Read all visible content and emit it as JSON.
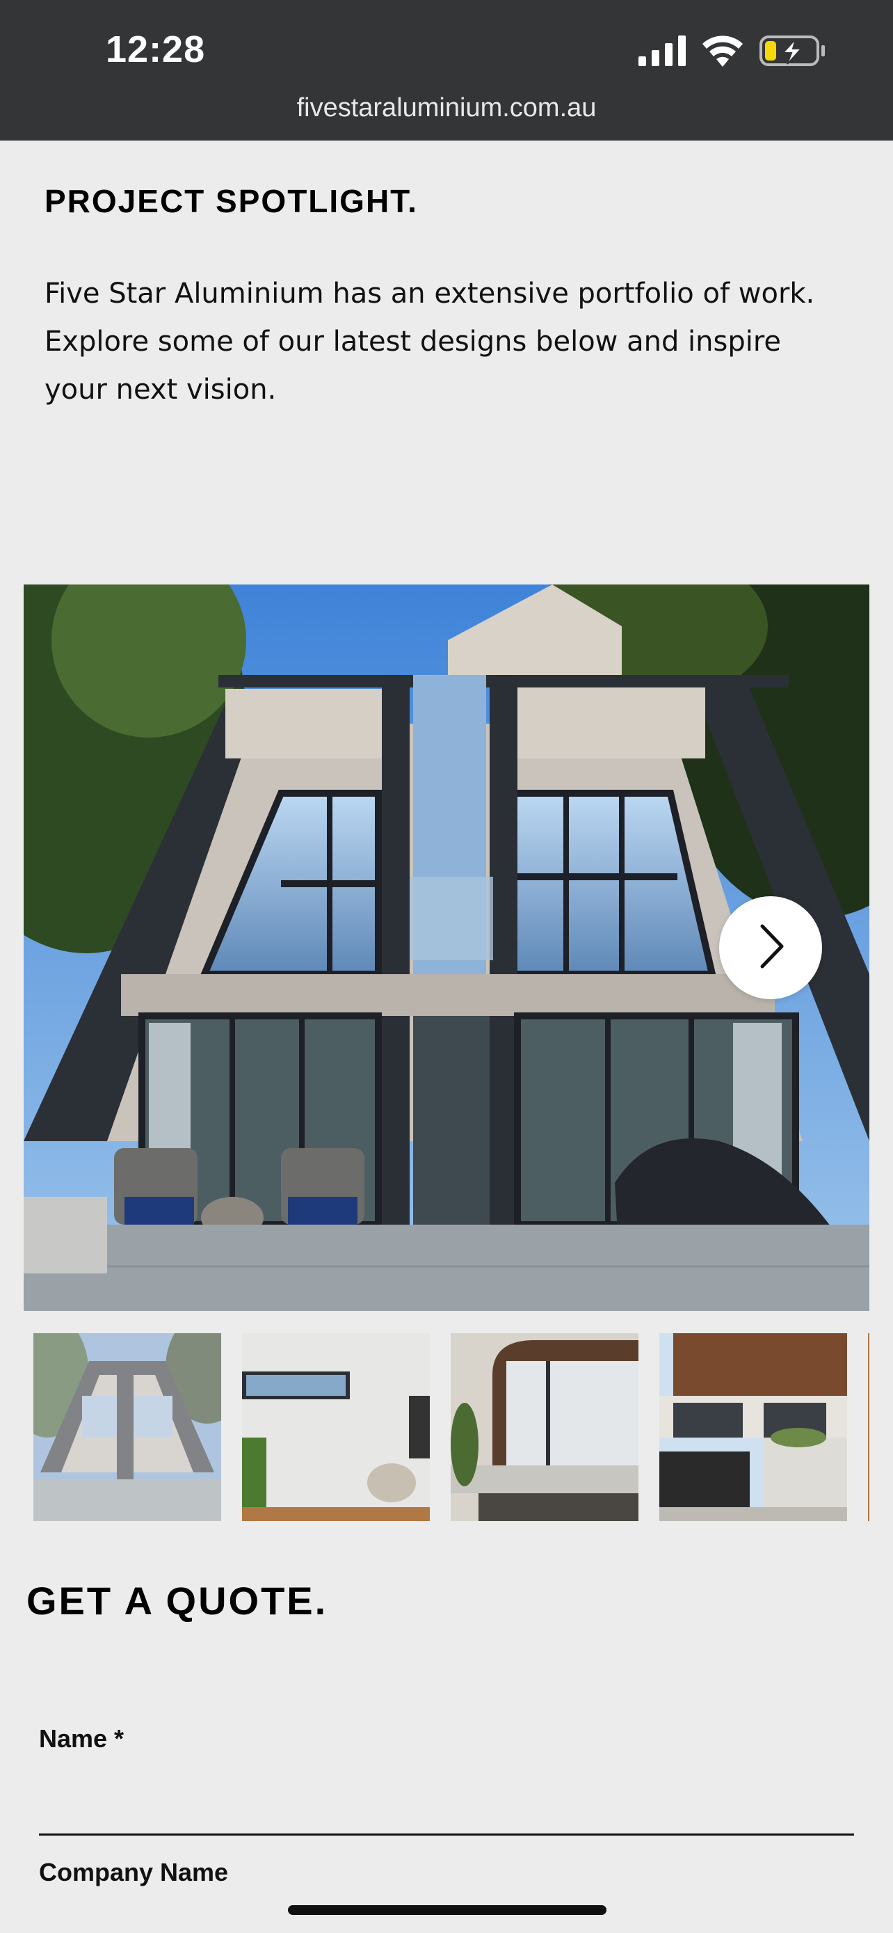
{
  "status_bar": {
    "time": "12:28",
    "url": "fivestaraluminium.com.au",
    "icons": [
      "signal-icon",
      "wifi-icon",
      "battery-charging-icon"
    ]
  },
  "spotlight": {
    "title": "PROJECT SPOTLIGHT.",
    "description": "Five Star Aluminium  has an extensive portfolio of work.  Explore some of our latest designs below and inspire your next vision."
  },
  "gallery": {
    "main_image": "a-frame-house-photo",
    "next_icon": "chevron-right-icon",
    "thumbnails": [
      "a-frame-house-thumb",
      "interior-room-thumb",
      "curved-facade-thumb",
      "timber-facade-garage-thumb"
    ],
    "selected_index": 0
  },
  "quote": {
    "title": "GET A QUOTE.",
    "fields": {
      "name_label": "Name *",
      "name_value": "",
      "company_label": "Company Name",
      "company_value": ""
    }
  },
  "colors": {
    "status_bar_bg": "#333537",
    "page_bg": "#ececec",
    "text": "#000000"
  }
}
